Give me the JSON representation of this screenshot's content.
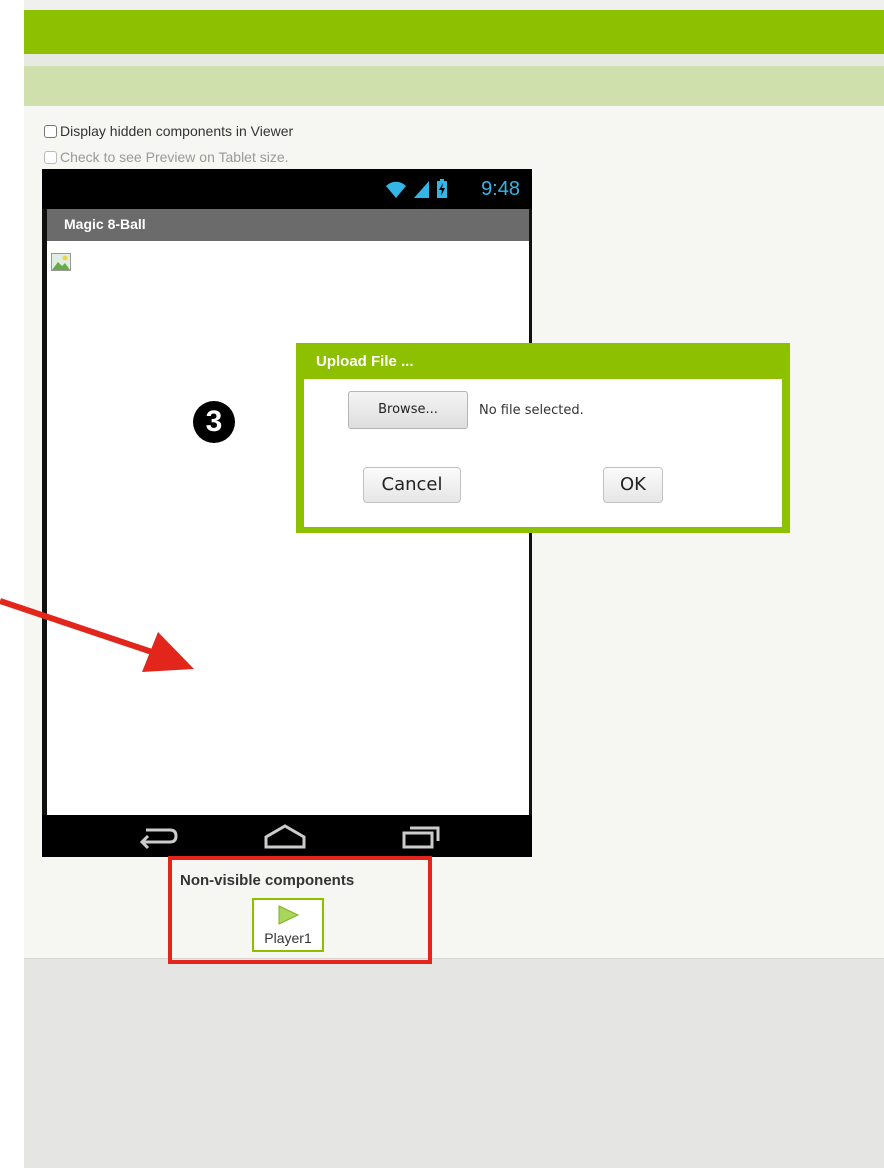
{
  "viewer": {
    "display_hidden_label": "Display hidden components in Viewer",
    "tablet_preview_label": "Check to see Preview on Tablet size."
  },
  "phone": {
    "status_time": "9:48",
    "app_title": "Magic 8-Ball",
    "status_color": "#33b5e5"
  },
  "dialog": {
    "title": "Upload File ...",
    "browse_label": "Browse...",
    "file_status": "No file selected.",
    "cancel_label": "Cancel",
    "ok_label": "OK",
    "accent_color": "#8dc100"
  },
  "annotation": {
    "step_number": "3",
    "highlight_color": "#e3261c"
  },
  "non_visible": {
    "title": "Non-visible components",
    "items": [
      {
        "label": "Player1",
        "icon": "play-icon"
      }
    ]
  }
}
